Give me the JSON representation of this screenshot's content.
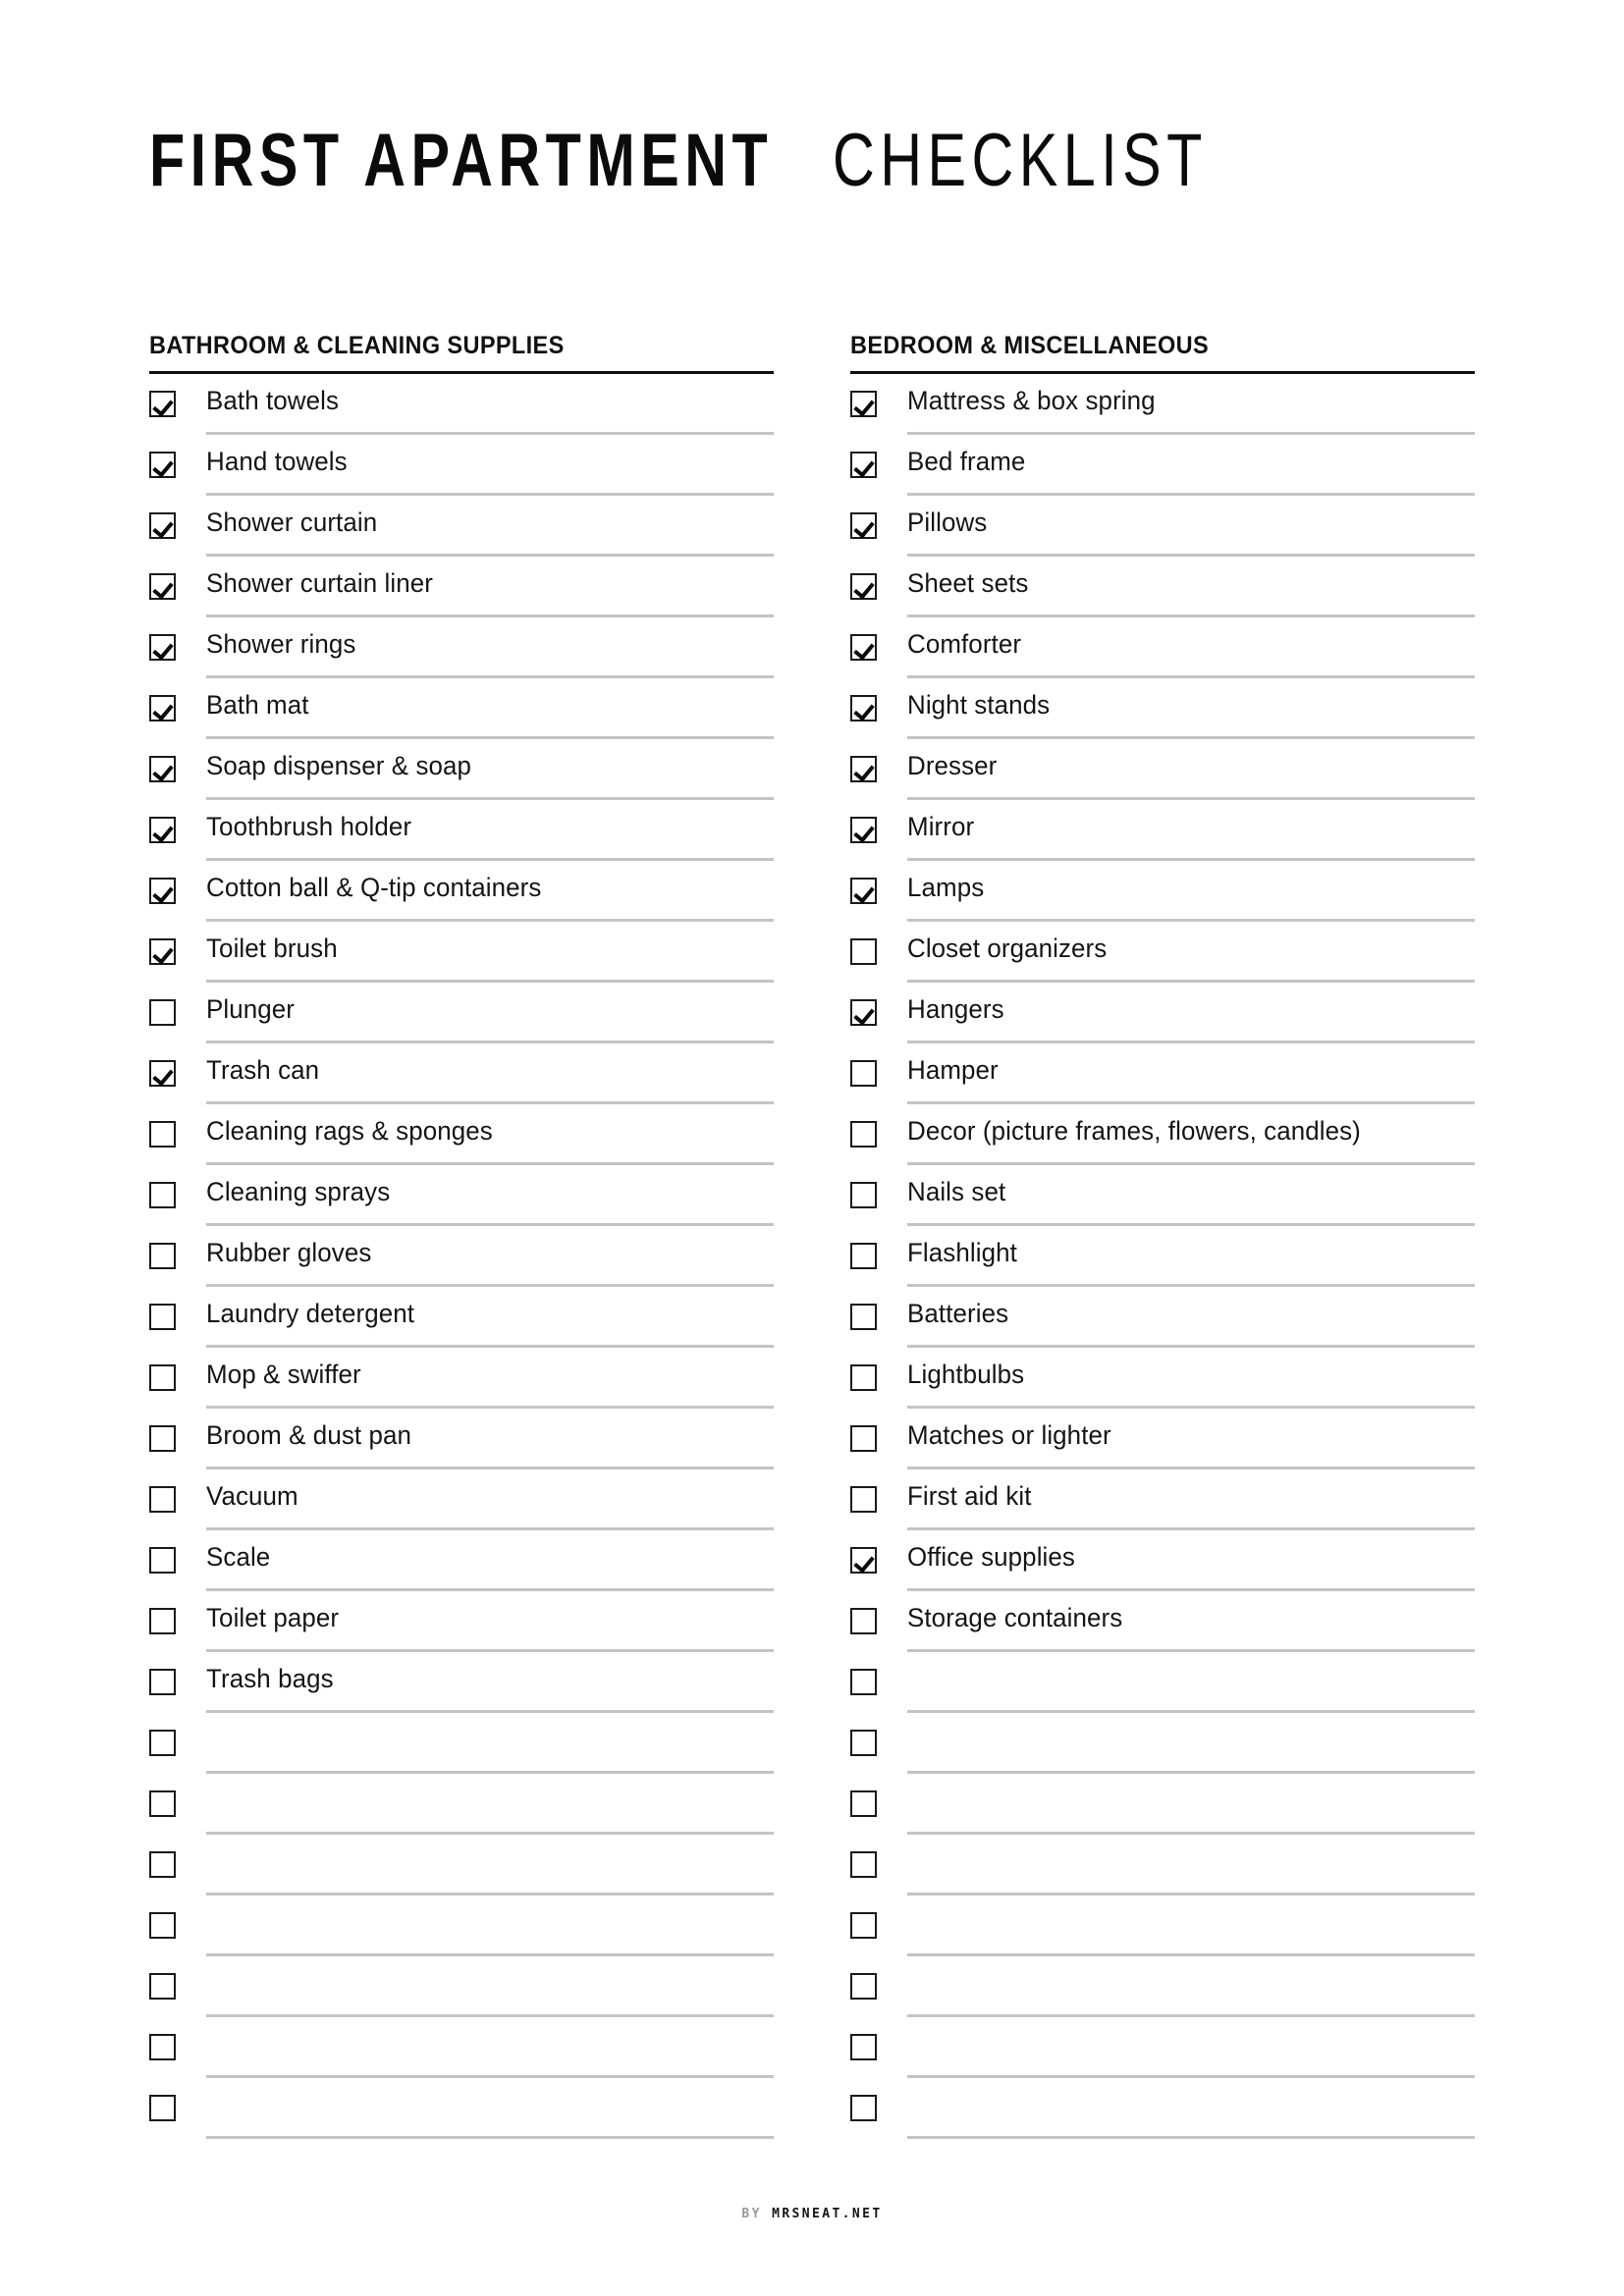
{
  "title": {
    "strong": "FIRST APARTMENT",
    "light": "CHECKLIST"
  },
  "columns": [
    {
      "header": "BATHROOM & CLEANING SUPPLIES",
      "items": [
        {
          "label": "Bath towels",
          "checked": true
        },
        {
          "label": "Hand towels",
          "checked": true
        },
        {
          "label": "Shower curtain",
          "checked": true
        },
        {
          "label": "Shower curtain liner",
          "checked": true
        },
        {
          "label": "Shower rings",
          "checked": true
        },
        {
          "label": "Bath mat",
          "checked": true
        },
        {
          "label": "Soap dispenser & soap",
          "checked": true
        },
        {
          "label": "Toothbrush holder",
          "checked": true
        },
        {
          "label": "Cotton ball & Q-tip containers",
          "checked": true
        },
        {
          "label": "Toilet brush",
          "checked": true
        },
        {
          "label": "Plunger",
          "checked": false
        },
        {
          "label": "Trash can",
          "checked": true
        },
        {
          "label": "Cleaning rags & sponges",
          "checked": false
        },
        {
          "label": "Cleaning sprays",
          "checked": false
        },
        {
          "label": "Rubber gloves",
          "checked": false
        },
        {
          "label": "Laundry detergent",
          "checked": false
        },
        {
          "label": "Mop & swiffer",
          "checked": false
        },
        {
          "label": "Broom & dust pan",
          "checked": false
        },
        {
          "label": "Vacuum",
          "checked": false
        },
        {
          "label": "Scale",
          "checked": false
        },
        {
          "label": "Toilet paper",
          "checked": false
        },
        {
          "label": "Trash bags",
          "checked": false
        },
        {
          "label": "",
          "checked": false
        },
        {
          "label": "",
          "checked": false
        },
        {
          "label": "",
          "checked": false
        },
        {
          "label": "",
          "checked": false
        },
        {
          "label": "",
          "checked": false
        },
        {
          "label": "",
          "checked": false
        },
        {
          "label": "",
          "checked": false
        }
      ]
    },
    {
      "header": "BEDROOM & MISCELLANEOUS",
      "items": [
        {
          "label": "Mattress & box spring",
          "checked": true
        },
        {
          "label": "Bed frame",
          "checked": true
        },
        {
          "label": "Pillows",
          "checked": true
        },
        {
          "label": "Sheet sets",
          "checked": true
        },
        {
          "label": "Comforter",
          "checked": true
        },
        {
          "label": "Night stands",
          "checked": true
        },
        {
          "label": "Dresser",
          "checked": true
        },
        {
          "label": "Mirror",
          "checked": true
        },
        {
          "label": "Lamps",
          "checked": true
        },
        {
          "label": "Closet organizers",
          "checked": false
        },
        {
          "label": "Hangers",
          "checked": true
        },
        {
          "label": "Hamper",
          "checked": false
        },
        {
          "label": "Decor (picture frames, flowers, candles)",
          "checked": false
        },
        {
          "label": "Nails set",
          "checked": false
        },
        {
          "label": "Flashlight",
          "checked": false
        },
        {
          "label": "Batteries",
          "checked": false
        },
        {
          "label": "Lightbulbs",
          "checked": false
        },
        {
          "label": "Matches or lighter",
          "checked": false
        },
        {
          "label": "First aid kit",
          "checked": false
        },
        {
          "label": "Office supplies",
          "checked": true
        },
        {
          "label": "Storage containers",
          "checked": false
        },
        {
          "label": "",
          "checked": false
        },
        {
          "label": "",
          "checked": false
        },
        {
          "label": "",
          "checked": false
        },
        {
          "label": "",
          "checked": false
        },
        {
          "label": "",
          "checked": false
        },
        {
          "label": "",
          "checked": false
        },
        {
          "label": "",
          "checked": false
        },
        {
          "label": "",
          "checked": false
        }
      ]
    }
  ],
  "footer": {
    "by": "BY",
    "site": "MRSNEAT.NET"
  },
  "colors": {
    "ink": "#111111",
    "rule": "#c4c4c4",
    "muted": "#9a9a9a"
  }
}
